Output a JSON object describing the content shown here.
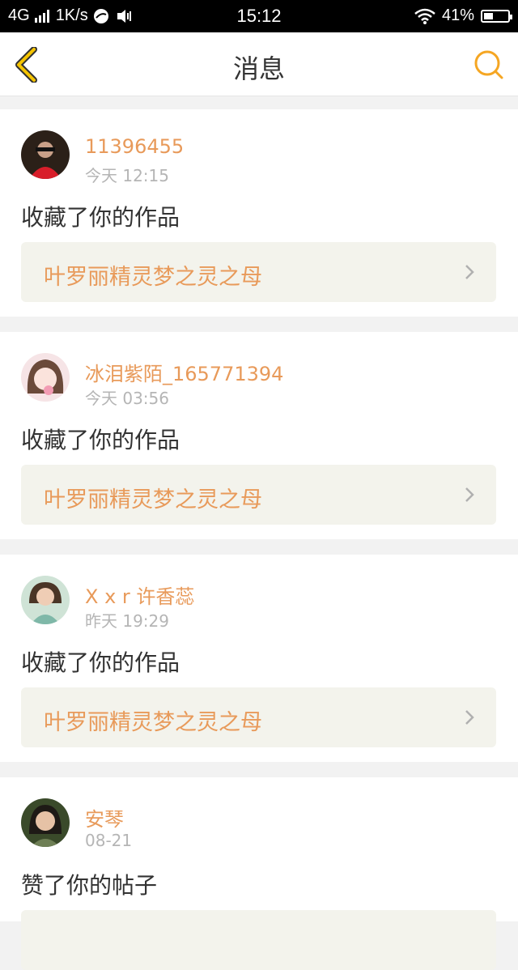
{
  "status_bar": {
    "network": "4G",
    "speed": "1K/s",
    "time": "15:12",
    "battery": "41%",
    "battery_level": 0.41
  },
  "header": {
    "title": "消息",
    "back_icon": "chevron-left-icon",
    "search_icon": "search-icon"
  },
  "colors": {
    "accent": "#e89a5a",
    "header_icon": "#f5a623",
    "text": "#333333",
    "meta": "#b5b5b5",
    "link_bg": "#f3f3ec"
  },
  "messages": [
    {
      "username": "11396455",
      "time": "今天 12:15",
      "action": "收藏了你的作品",
      "work_title": "叶罗丽精灵梦之灵之母"
    },
    {
      "username": "冰泪紫陌_165771394",
      "time": "今天 03:56",
      "action": "收藏了你的作品",
      "work_title": "叶罗丽精灵梦之灵之母"
    },
    {
      "username": "X x r 许香蕊",
      "time": "昨天 19:29",
      "action": "收藏了你的作品",
      "work_title": "叶罗丽精灵梦之灵之母"
    },
    {
      "username": "安琴",
      "time": "08-21",
      "action": "赞了你的帖子",
      "work_title": ""
    }
  ]
}
